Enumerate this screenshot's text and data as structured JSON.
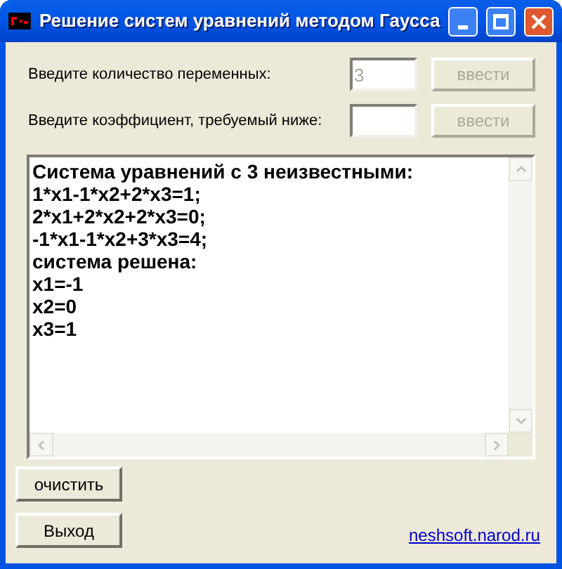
{
  "window": {
    "title": "Решение систем уравнений методом Гаусса"
  },
  "inputs": [
    {
      "label": "Введите количество переменных:",
      "value": "3",
      "disabled": true,
      "button": "ввести",
      "button_disabled": true
    },
    {
      "label": "Введите коэффициент, требуемый ниже:",
      "disabled": false,
      "button": "ввести",
      "button_disabled": true
    }
  ],
  "output": {
    "lines": [
      "Система уравнений с 3 неизвестными:",
      "1*x1-1*x2+2*x3=1;",
      "2*x1+2*x2+2*x3=0;",
      "-1*x1-1*x2+3*x3=4;",
      "система решена:",
      "x1=-1",
      "x2=0",
      "x3=1"
    ]
  },
  "buttons": [
    "очистить",
    "Выход"
  ],
  "link": "neshsoft.narod.ru"
}
